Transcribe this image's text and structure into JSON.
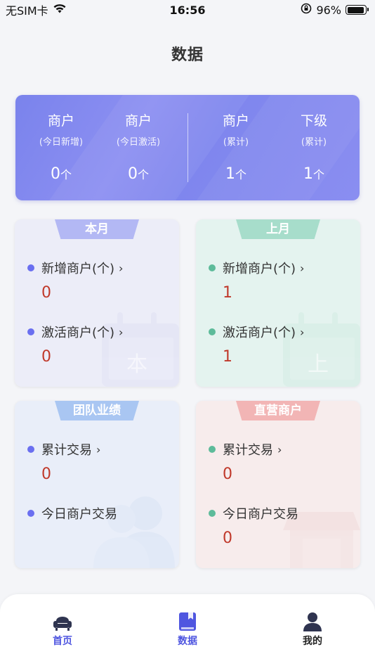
{
  "status_bar": {
    "carrier": "无SIM卡",
    "time": "16:56",
    "battery_pct": "96%"
  },
  "page": {
    "title": "数据"
  },
  "summary": [
    {
      "title": "商户",
      "sub": "(今日新增)",
      "value": "0",
      "unit": "个"
    },
    {
      "title": "商户",
      "sub": "(今日激活)",
      "value": "0",
      "unit": "个"
    },
    {
      "title": "商户",
      "sub": "(累计)",
      "value": "1",
      "unit": "个"
    },
    {
      "title": "下级",
      "sub": "(累计)",
      "value": "1",
      "unit": "个"
    }
  ],
  "cards": {
    "this_month": {
      "tab": "本月",
      "watermark": "本",
      "m1_label": "新增商户(个)",
      "m1_value": "0",
      "m2_label": "激活商户(个)",
      "m2_value": "0"
    },
    "last_month": {
      "tab": "上月",
      "watermark": "上",
      "m1_label": "新增商户(个)",
      "m1_value": "1",
      "m2_label": "激活商户(个)",
      "m2_value": "1"
    },
    "team": {
      "tab": "团队业绩",
      "m1_label": "累计交易",
      "m1_value": "0",
      "m2_label": "今日商户交易"
    },
    "direct": {
      "tab": "直营商户",
      "m1_label": "累计交易",
      "m1_value": "0",
      "m2_label": "今日商户交易",
      "m2_value": "0"
    }
  },
  "colors": {
    "summary_bg": "#7f86ee",
    "value_red": "#c0392b",
    "dot_purple": "#6a6ff0",
    "dot_green": "#5dbb9a",
    "nav_active": "#4f56e0"
  },
  "icons": {
    "wifi": "wifi-icon",
    "rotation_lock": "rotation-lock-icon",
    "battery": "battery-icon",
    "home": "sofa-icon",
    "data": "book-icon",
    "mine": "person-icon"
  },
  "nav": [
    {
      "label": "首页"
    },
    {
      "label": "数据"
    },
    {
      "label": "我的"
    }
  ]
}
